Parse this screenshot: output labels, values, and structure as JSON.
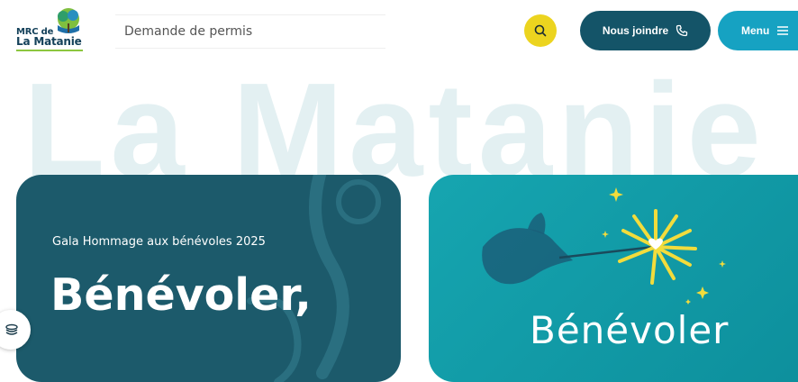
{
  "header": {
    "logo": {
      "line1": "MRC de",
      "line2": "La Matanie"
    },
    "permit_link": "Demande de permis",
    "search_icon": "search-icon",
    "contact_label": "Nous joindre",
    "contact_icon": "phone-icon",
    "menu_label": "Menu",
    "menu_icon": "hamburger-icon"
  },
  "hero": {
    "background_title": "La Matanie"
  },
  "cards": {
    "left": {
      "eyebrow": "Gala Hommage aux bénévoles 2025",
      "heading": "Bénévoler,"
    },
    "right": {
      "heading": "Bénévoler"
    }
  },
  "colors": {
    "navy": "#145468",
    "teal": "#16a2c2",
    "yellow": "#ecd41f",
    "card_dark": "#1c5a6b",
    "card_teal": "#16a5b0"
  }
}
